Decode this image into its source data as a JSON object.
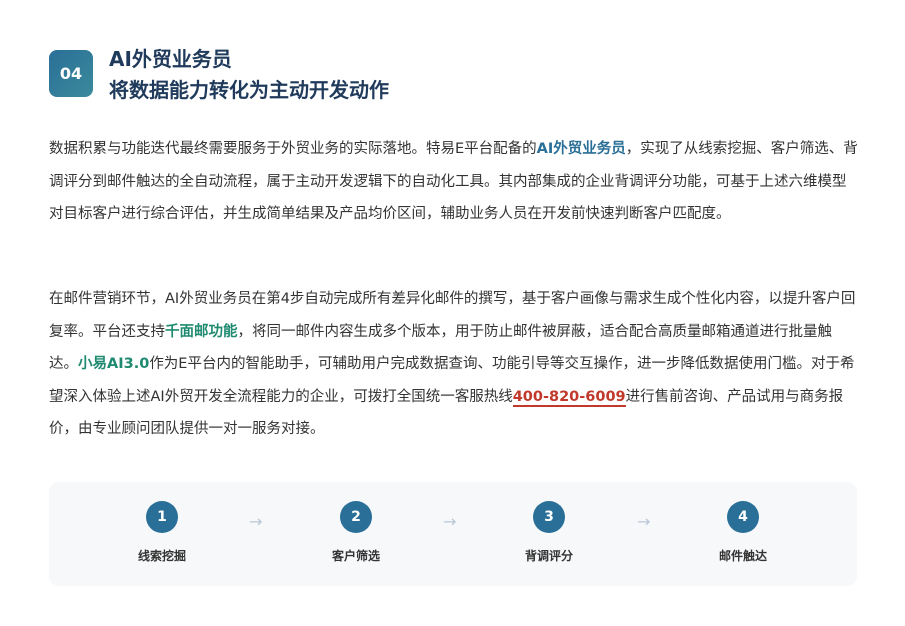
{
  "header": {
    "badge": "04",
    "title": "AI外贸业务员",
    "subtitle": "将数据能力转化为主动开发动作"
  },
  "p1": {
    "t1": "数据积累与功能迭代最终需要服务于外贸业务的实际落地。特易E平台配备的",
    "hl1": "AI外贸业务员",
    "t2": "，实现了从线索挖掘、客户筛选、背调评分到邮件触达的全自动流程，属于主动开发逻辑下的自动化工具。其内部集成的企业背调评分功能，可基于上述六维模型对目标客户进行综合评估，并生成简单结果及产品均价区间，辅助业务人员在开发前快速判断客户匹配度。"
  },
  "p2": {
    "t1": "在邮件营销环节，AI外贸业务员在第4步自动完成所有差异化邮件的撰写，基于客户画像与需求生成个性化内容，以提升客户回复率。平台还支持",
    "hl1": "千面邮功能",
    "t2": "，将同一邮件内容生成多个版本，用于防止邮件被屏蔽，适合配合高质量邮箱通道进行批量触达。",
    "hl2": "小易AI3.0",
    "t3": "作为E平台内的智能助手，可辅助用户完成数据查询、功能引导等交互操作，进一步降低数据使用门槛。对于希望深入体验上述AI外贸开发全流程能力的企业，可拨打全国统一客服热线",
    "hl3": "400-820-6009",
    "t4": "进行售前咨询、产品试用与商务报价，由专业顾问团队提供一对一服务对接。"
  },
  "steps": [
    {
      "num": "1",
      "label": "线索挖掘"
    },
    {
      "num": "2",
      "label": "客户筛选"
    },
    {
      "num": "3",
      "label": "背调评分"
    },
    {
      "num": "4",
      "label": "邮件触达"
    }
  ],
  "arrow": "→",
  "colors": {
    "accent": "#2a6f97",
    "title": "#1f3a5a",
    "teal": "#1f8a70",
    "phone": "#c0392b"
  }
}
